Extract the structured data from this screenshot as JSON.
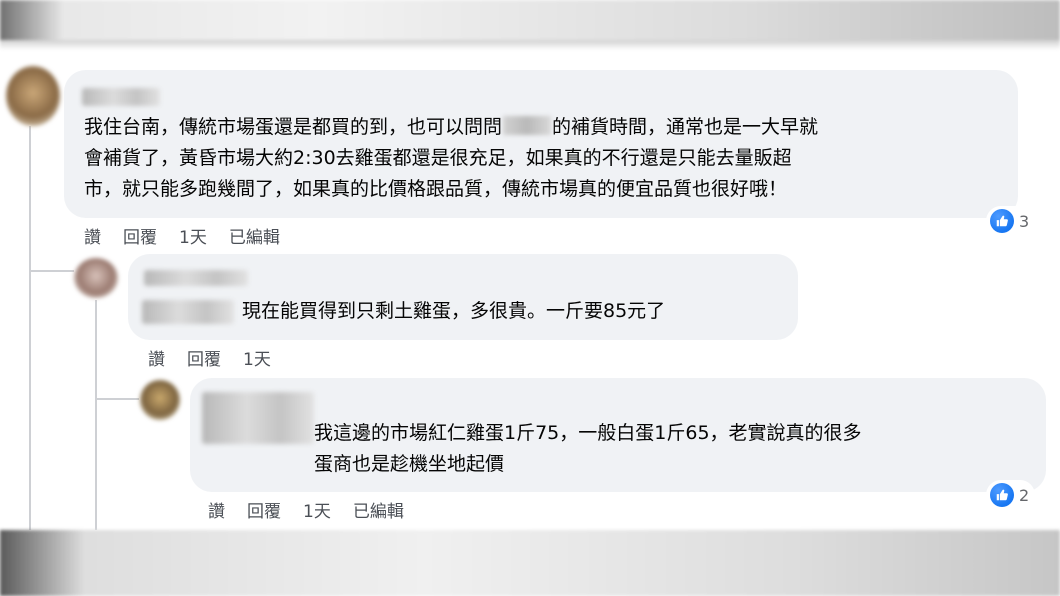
{
  "comments": [
    {
      "text_before": "我住台南，傳統市場蛋還是都買的到，也可以問問",
      "text_after": "的補貨時間，通常也是一大早就\n會補貨了，黃昏市場大約2:30去雞蛋都還是很充足，如果真的不行還是只能去量販超\n市，就只能多跑幾間了，如果真的比價格跟品質，傳統市場真的便宜品質也很好哦！",
      "actions": {
        "like": "讚",
        "reply": "回覆",
        "time": "1天",
        "edited": "已編輯"
      },
      "reaction_count": "3"
    },
    {
      "text": "現在能買得到只剩土雞蛋，多很貴。一斤要85元了",
      "actions": {
        "like": "讚",
        "reply": "回覆",
        "time": "1天"
      }
    },
    {
      "text": "我這邊的市場紅仁雞蛋1斤75，一般白蛋1斤65，老實說真的很多\n蛋商也是趁機坐地起價",
      "actions": {
        "like": "讚",
        "reply": "回覆",
        "time": "1天",
        "edited": "已編輯"
      },
      "reaction_count": "2"
    }
  ],
  "colors": {
    "bubble": "#f0f2f5",
    "like_blue": "#1877f2",
    "action_text": "#4b4f56",
    "thread_line": "#ced0d4"
  },
  "icons": {
    "reaction": "like-thumbs-up-icon"
  }
}
